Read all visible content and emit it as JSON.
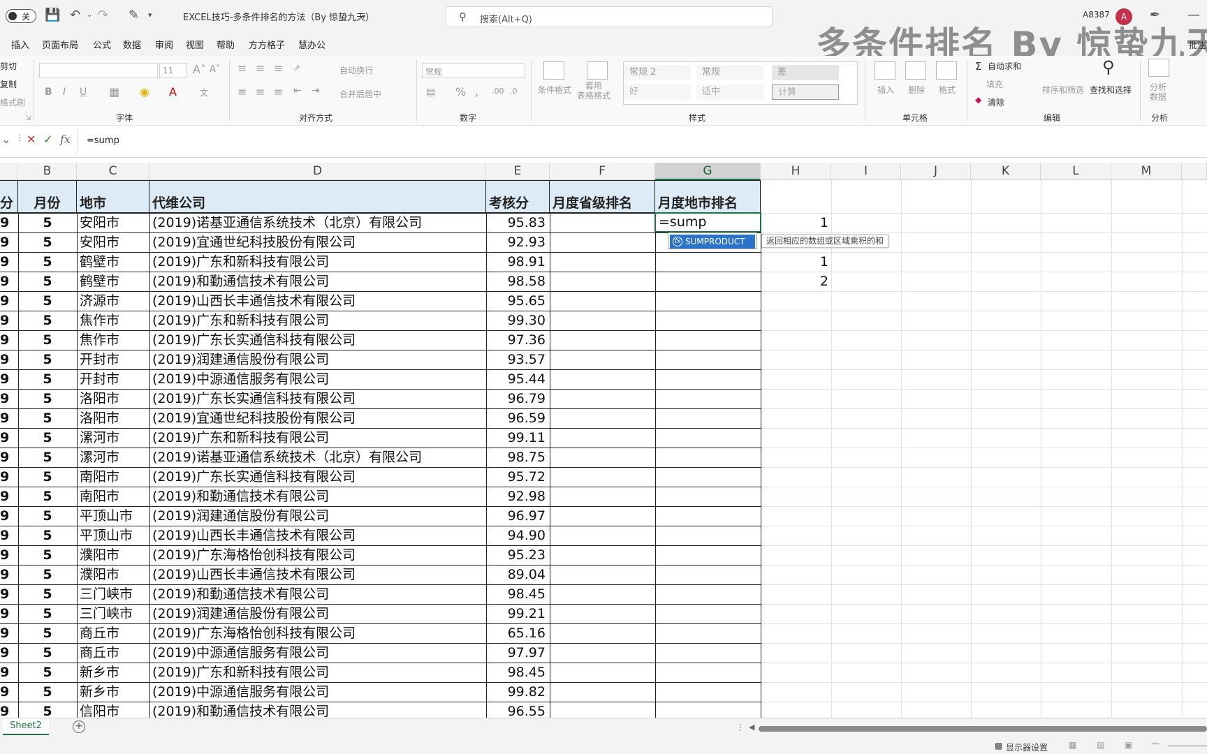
{
  "titlebar": {
    "autosave_label": "关",
    "doc_title": "EXCEL技巧-多条件排名的方法（By 惊蛰九天）",
    "search_placeholder": "搜索(Alt+Q)",
    "user_id": "A8387",
    "avatar_initial": "A",
    "watermark": "多条件排名 By 惊蛰九天"
  },
  "menu": [
    "插入",
    "页面布局",
    "公式",
    "数据",
    "审阅",
    "视图",
    "帮助",
    "方方格子",
    "慧办公"
  ],
  "ribbon": {
    "clipboard": {
      "cut": "剪切",
      "copy": "复制",
      "painter": "格式刷"
    },
    "font_group": "字体",
    "font_size": "11",
    "align_group": "对齐方式",
    "wrap": "自动换行",
    "merge": "合并后居中",
    "number_group": "数字",
    "number_format": "常规",
    "styles_group": "样式",
    "conditional": "条件格式",
    "table_format": "套用\n表格格式",
    "styles": [
      "常规 2",
      "常规",
      "差",
      "好",
      "适中",
      "计算"
    ],
    "cells_group": "单元格",
    "insert": "插入",
    "delete": "删除",
    "format": "格式",
    "editing_group": "编辑",
    "autosum": "自动求和",
    "fill": "填充",
    "clear": "清除",
    "sort_filter": "排序和筛选",
    "find_select": "查找和选择",
    "analysis_group": "分析",
    "analyze_data": "分析\n数据",
    "comments": "批注"
  },
  "formula_bar": {
    "content": "=sump"
  },
  "columns": [
    "B",
    "C",
    "D",
    "E",
    "F",
    "G",
    "H",
    "I",
    "J",
    "K",
    "L",
    "M"
  ],
  "active_column": "G",
  "table": {
    "headers": {
      "a": "分",
      "b": "月份",
      "c": "地市",
      "d": "代维公司",
      "e": "考核分",
      "f": "月度省级排名",
      "g": "月度地市排名"
    },
    "rows": [
      {
        "a": "9",
        "b": "5",
        "c": "安阳市",
        "d": "(2019)诺基亚通信系统技术（北京）有限公司",
        "e": "95.83",
        "h": "1"
      },
      {
        "a": "9",
        "b": "5",
        "c": "安阳市",
        "d": "(2019)宜通世纪科技股份有限公司",
        "e": "92.93",
        "h": ""
      },
      {
        "a": "9",
        "b": "5",
        "c": "鹤壁市",
        "d": "(2019)广东和新科技有限公司",
        "e": "98.91",
        "h": "1"
      },
      {
        "a": "9",
        "b": "5",
        "c": "鹤壁市",
        "d": "(2019)和勤通信技术有限公司",
        "e": "98.58",
        "h": "2"
      },
      {
        "a": "9",
        "b": "5",
        "c": "济源市",
        "d": "(2019)山西长丰通信技术有限公司",
        "e": "95.65",
        "h": ""
      },
      {
        "a": "9",
        "b": "5",
        "c": "焦作市",
        "d": "(2019)广东和新科技有限公司",
        "e": "99.30",
        "h": ""
      },
      {
        "a": "9",
        "b": "5",
        "c": "焦作市",
        "d": "(2019)广东长实通信科技有限公司",
        "e": "97.36",
        "h": ""
      },
      {
        "a": "9",
        "b": "5",
        "c": "开封市",
        "d": "(2019)润建通信股份有限公司",
        "e": "93.57",
        "h": ""
      },
      {
        "a": "9",
        "b": "5",
        "c": "开封市",
        "d": "(2019)中源通信服务有限公司",
        "e": "95.44",
        "h": ""
      },
      {
        "a": "9",
        "b": "5",
        "c": "洛阳市",
        "d": "(2019)广东长实通信科技有限公司",
        "e": "96.79",
        "h": ""
      },
      {
        "a": "9",
        "b": "5",
        "c": "洛阳市",
        "d": "(2019)宜通世纪科技股份有限公司",
        "e": "96.59",
        "h": ""
      },
      {
        "a": "9",
        "b": "5",
        "c": "漯河市",
        "d": "(2019)广东和新科技有限公司",
        "e": "99.11",
        "h": ""
      },
      {
        "a": "9",
        "b": "5",
        "c": "漯河市",
        "d": "(2019)诺基亚通信系统技术（北京）有限公司",
        "e": "98.75",
        "h": ""
      },
      {
        "a": "9",
        "b": "5",
        "c": "南阳市",
        "d": "(2019)广东长实通信科技有限公司",
        "e": "95.72",
        "h": ""
      },
      {
        "a": "9",
        "b": "5",
        "c": "南阳市",
        "d": "(2019)和勤通信技术有限公司",
        "e": "92.98",
        "h": ""
      },
      {
        "a": "9",
        "b": "5",
        "c": "平顶山市",
        "d": "(2019)润建通信股份有限公司",
        "e": "96.97",
        "h": ""
      },
      {
        "a": "9",
        "b": "5",
        "c": "平顶山市",
        "d": "(2019)山西长丰通信技术有限公司",
        "e": "94.90",
        "h": ""
      },
      {
        "a": "9",
        "b": "5",
        "c": "濮阳市",
        "d": "(2019)广东海格怡创科技有限公司",
        "e": "95.23",
        "h": ""
      },
      {
        "a": "9",
        "b": "5",
        "c": "濮阳市",
        "d": "(2019)山西长丰通信技术有限公司",
        "e": "89.04",
        "h": ""
      },
      {
        "a": "9",
        "b": "5",
        "c": "三门峡市",
        "d": "(2019)和勤通信技术有限公司",
        "e": "98.45",
        "h": ""
      },
      {
        "a": "9",
        "b": "5",
        "c": "三门峡市",
        "d": "(2019)润建通信股份有限公司",
        "e": "99.21",
        "h": ""
      },
      {
        "a": "9",
        "b": "5",
        "c": "商丘市",
        "d": "(2019)广东海格怡创科技有限公司",
        "e": "65.16",
        "h": ""
      },
      {
        "a": "9",
        "b": "5",
        "c": "商丘市",
        "d": "(2019)中源通信服务有限公司",
        "e": "97.97",
        "h": ""
      },
      {
        "a": "9",
        "b": "5",
        "c": "新乡市",
        "d": "(2019)广东和新科技有限公司",
        "e": "98.45",
        "h": ""
      },
      {
        "a": "9",
        "b": "5",
        "c": "新乡市",
        "d": "(2019)中源通信服务有限公司",
        "e": "99.82",
        "h": ""
      },
      {
        "a": "9",
        "b": "5",
        "c": "信阳市",
        "d": "(2019)和勤通信技术有限公司",
        "e": "96.55",
        "h": ""
      }
    ]
  },
  "edit_cell": {
    "value": "=sump"
  },
  "autocomplete": {
    "item": "SUMPRODUCT",
    "tooltip": "返回相应的数组或区域乘积的和"
  },
  "sheet_tab": "Sheet2",
  "status": {
    "display_settings": "显示器设置"
  }
}
